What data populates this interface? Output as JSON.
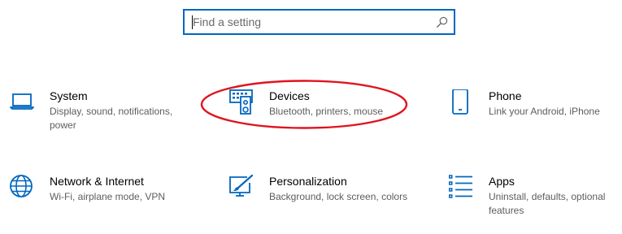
{
  "search": {
    "placeholder": "Find a setting",
    "value": ""
  },
  "categories": [
    {
      "title": "System",
      "description": "Display, sound, notifications, power",
      "icon": "laptop-icon"
    },
    {
      "title": "Devices",
      "description": "Bluetooth, printers, mouse",
      "icon": "devices-icon"
    },
    {
      "title": "Phone",
      "description": "Link your Android, iPhone",
      "icon": "phone-icon"
    },
    {
      "title": "Network & Internet",
      "description": "Wi-Fi, airplane mode, VPN",
      "icon": "globe-icon"
    },
    {
      "title": "Personalization",
      "description": "Background, lock screen, colors",
      "icon": "paint-icon"
    },
    {
      "title": "Apps",
      "description": "Uninstall, defaults, optional features",
      "icon": "apps-list-icon"
    }
  ],
  "colors": {
    "accent": "#0067c0",
    "annotation": "#e0141e",
    "description": "#5d5d5d"
  }
}
